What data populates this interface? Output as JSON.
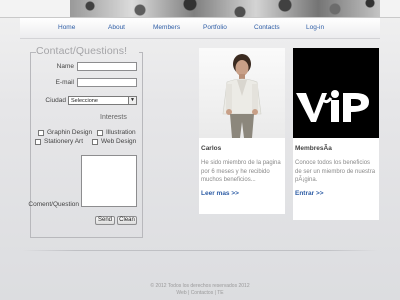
{
  "nav": {
    "home": "Home",
    "about": "About",
    "members": "Members",
    "portfolio": "Portfolio",
    "contacts": "Contacts",
    "login": "Log-in"
  },
  "form": {
    "legend": "Contact/Questions!",
    "name_label": "Name",
    "email_label": "E-mail",
    "city_label": "Ciudad",
    "city_value": "Seleccione",
    "interests_label": "Interests",
    "interests": [
      "Graphin Design",
      "Illustration",
      "Stationery Art",
      "Web Design"
    ],
    "comment_label": "Coment/Question",
    "send_label": "Send",
    "clean_label": "Clean"
  },
  "cards": [
    {
      "title": "Carlos",
      "text": "He sido miembro de la pagina por 6 meses y he recibido muchos beneficios...",
      "link": "Leer mas >>"
    },
    {
      "title": "MembresÃ­a",
      "text": "Conoce todos los beneficios de ser un miembro de nuestra pÃ¡gina.",
      "link": "Entrar >>",
      "logo_text": "VIP"
    }
  ],
  "footer": {
    "line1": "© 2012    Todos los derechos reservados  2012",
    "line2": "Web | Contactos | TE"
  },
  "colors": {
    "link": "#2f5ea6",
    "background": "#e3e4e7"
  }
}
